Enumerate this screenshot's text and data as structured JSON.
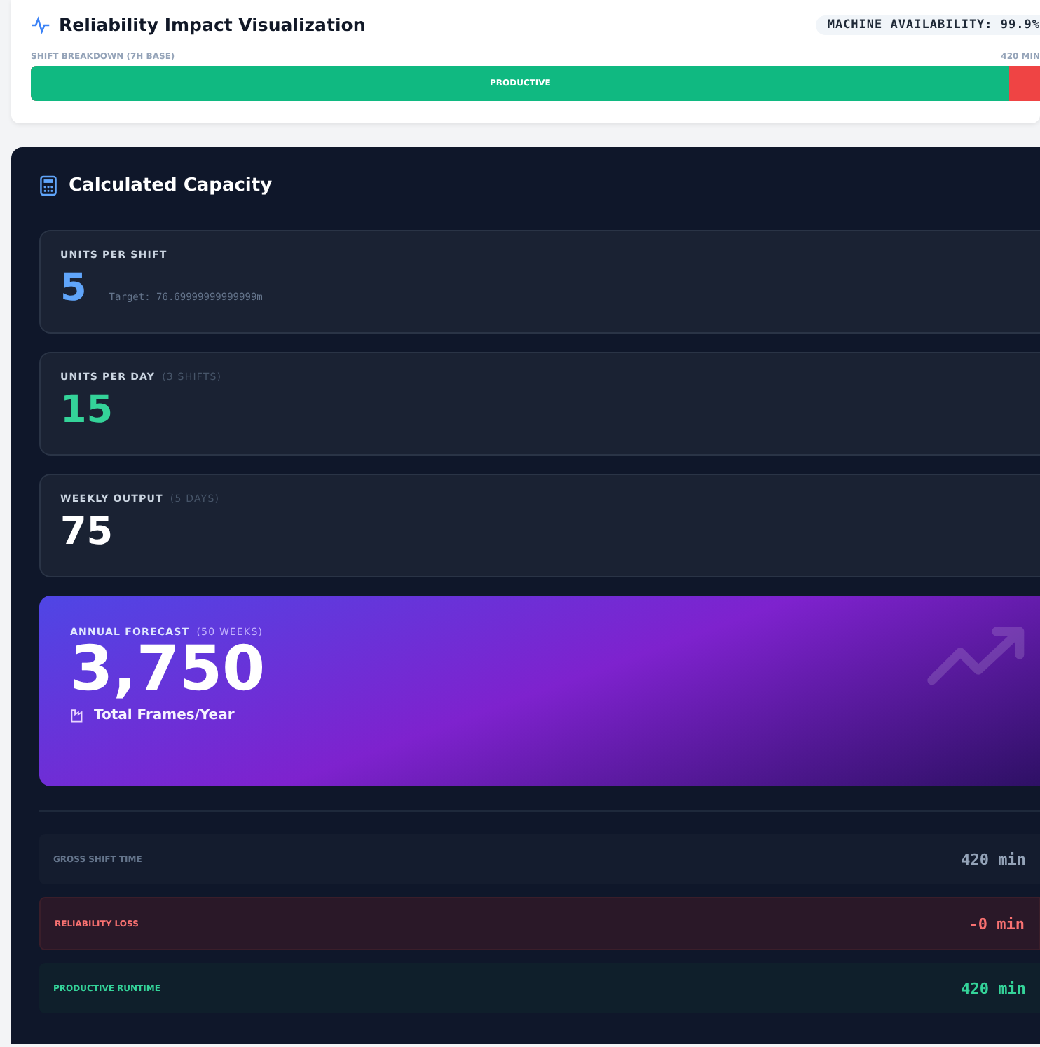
{
  "header": {
    "title": "Reliability Impact Visualization",
    "availability_badge": "MACHINE AVAILABILITY: 99.9%"
  },
  "breakdown": {
    "label": "SHIFT BREAKDOWN (7H BASE)",
    "total": "420 MIN",
    "productive": {
      "label": "PRODUCTIVE",
      "level": 0.97
    }
  },
  "capacity": {
    "title": "Calculated Capacity",
    "stats": [
      {
        "kind": "blue",
        "label": "UNITS PER SHIFT",
        "value": "5",
        "note": "Target: 76.69999999999999m"
      },
      {
        "kind": "green",
        "label": "UNITS PER DAY",
        "qualifier": "(3 SHIFTS)",
        "value": "15"
      },
      {
        "kind": "white",
        "label": "WEEKLY OUTPUT",
        "qualifier": "(5 DAYS)",
        "value": "75"
      }
    ],
    "forecast": {
      "label": "ANNUAL FORECAST",
      "qualifier": "(50 WEEKS)",
      "value": "3,750",
      "caption": "Total Frames/Year"
    },
    "rows": [
      {
        "kind": "neutral",
        "label": "GROSS SHIFT TIME",
        "value": "420 min"
      },
      {
        "kind": "loss",
        "label": "RELIABILITY LOSS",
        "value": "-0 min"
      },
      {
        "kind": "gain",
        "label": "PRODUCTIVE RUNTIME",
        "value": "420 min"
      }
    ]
  }
}
